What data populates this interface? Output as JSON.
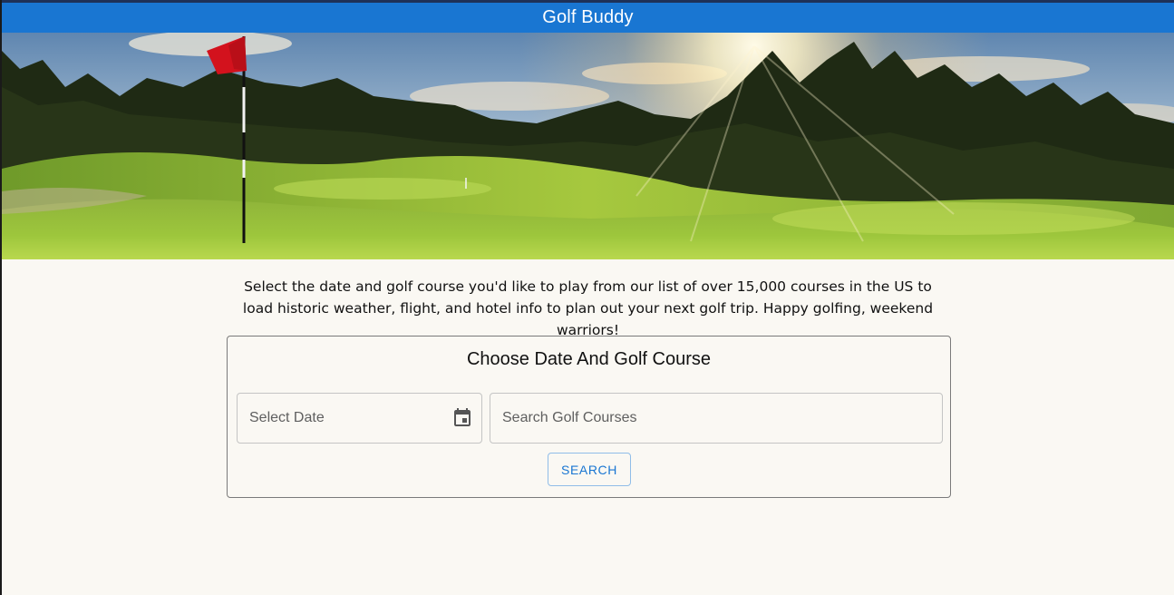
{
  "app": {
    "title": "Golf Buddy"
  },
  "intro": {
    "text": "Select the date and golf course you'd like to play from our list of over 15,000 courses in the US to load historic weather, flight, and hotel info to plan out your next golf trip. Happy golfing, weekend warriors!"
  },
  "search_card": {
    "title": "Choose Date And Golf Course",
    "date_field": {
      "placeholder": "Select Date",
      "value": "",
      "icon": "calendar-icon"
    },
    "course_field": {
      "placeholder": "Search Golf Courses",
      "value": ""
    },
    "search_button": "SEARCH"
  },
  "colors": {
    "app_bar": "#1976d2",
    "page_background": "#faf8f3",
    "button_text": "#1976d2"
  }
}
